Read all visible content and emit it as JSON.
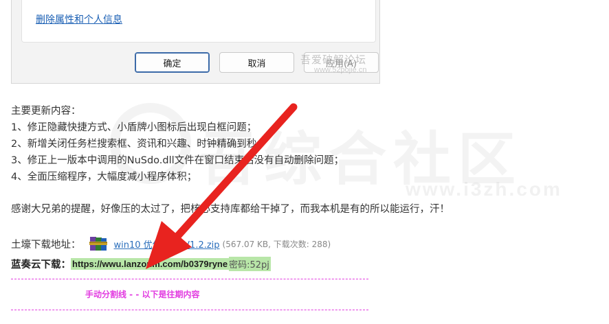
{
  "dialog": {
    "remove_link": "删除属性和个人信息",
    "ok_label": "确定",
    "cancel_label": "取消",
    "apply_label": "应用(A)",
    "watermark": "吾爱破解论坛",
    "watermark_url": "www.52pojie.cn"
  },
  "background_watermark": {
    "text": "吾综合社区",
    "url": "www.i3zh.com"
  },
  "article": {
    "heading": "主要更新内容：",
    "items": [
      "1、修正隐藏快捷方式、小盾牌小图标后出现白框问题；",
      "2、新增关闭任务栏搜索框、资讯和兴趣、时钟精确到秒；",
      "3、修正上一版本中调用的NuSdo.dll文件在窗口结束后没有自动删除问题；",
      "4、全面压缩程序，大幅度减小程序体积；"
    ],
    "thanks": "感谢大兄弟的提醒，好像压的太过了，把核心支持库都给干掉了，而我本机是有的所以能运行，汗！"
  },
  "download": {
    "local_label": "土壕下载地址：",
    "file_name": "win10 优化工具_V1.2.zip",
    "file_meta": "(567.07 KB, 下载次数: 288)",
    "icon": "winrar-archive-icon",
    "lanzou_label": "蓝奏云下载：",
    "lanzou_url": "https://wwu.lanzoum.com/b0379ryne",
    "lanzou_password": "密码:52pj"
  },
  "separator": {
    "text": "手动分割线 - - 以下是往期内容"
  },
  "colors": {
    "arrow": "#e8231f",
    "separator": "#e23be0",
    "highlight": "#b8e6a8",
    "link": "#2a6ebb"
  }
}
